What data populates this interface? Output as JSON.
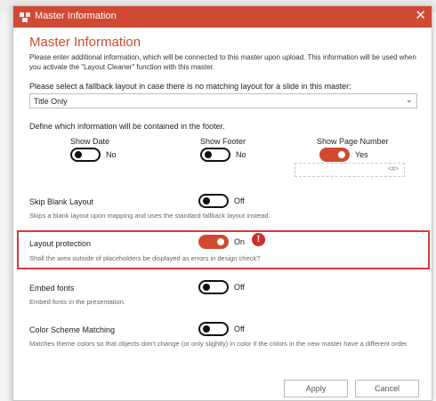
{
  "window": {
    "title": "Master Information",
    "close_glyph": "✕",
    "accent_color": "#d04a33",
    "icon": "app-logo-icon"
  },
  "heading": "Master Information",
  "intro": "Please enter additional information, which will be connected to this master upon upload. This information will be used when you activate the \"Layout Cleaner\" function with this master.",
  "fallback": {
    "label": "Please select a fallback layout in case there is no matching layout for a slide in this master:",
    "selected": "Title Only",
    "chevron": "⌄"
  },
  "footer": {
    "label": "Define which information will be contained in the footer.",
    "show_date": {
      "label": "Show Date",
      "state": "No",
      "on": false
    },
    "show_footer": {
      "label": "Show Footer",
      "state": "No",
      "on": false
    },
    "show_page_number": {
      "label": "Show Page Number",
      "state": "Yes",
      "on": true
    },
    "page_placeholder": "<#>"
  },
  "skip_blank": {
    "label": "Skip Blank Layout",
    "state": "Off",
    "on": false,
    "desc": "Skips a blank layout upon mapping and uses the standard fallback layout instead."
  },
  "layout_protection": {
    "label": "Layout protection",
    "state": "On",
    "on": true,
    "warning_glyph": "!",
    "desc": "Shall the area outside of placeholders be displayed as errors in design check?"
  },
  "embed_fonts": {
    "label": "Embed fonts",
    "state": "Off",
    "on": false,
    "desc": "Embed fonts in the presentation."
  },
  "color_scheme": {
    "label": "Color Scheme Matching",
    "state": "Off",
    "on": false,
    "desc": "Matches theme colors so that objects don't change (or only slightly) in color if the colors in the new master have a different order."
  },
  "buttons": {
    "apply": "Apply",
    "cancel": "Cancel"
  }
}
